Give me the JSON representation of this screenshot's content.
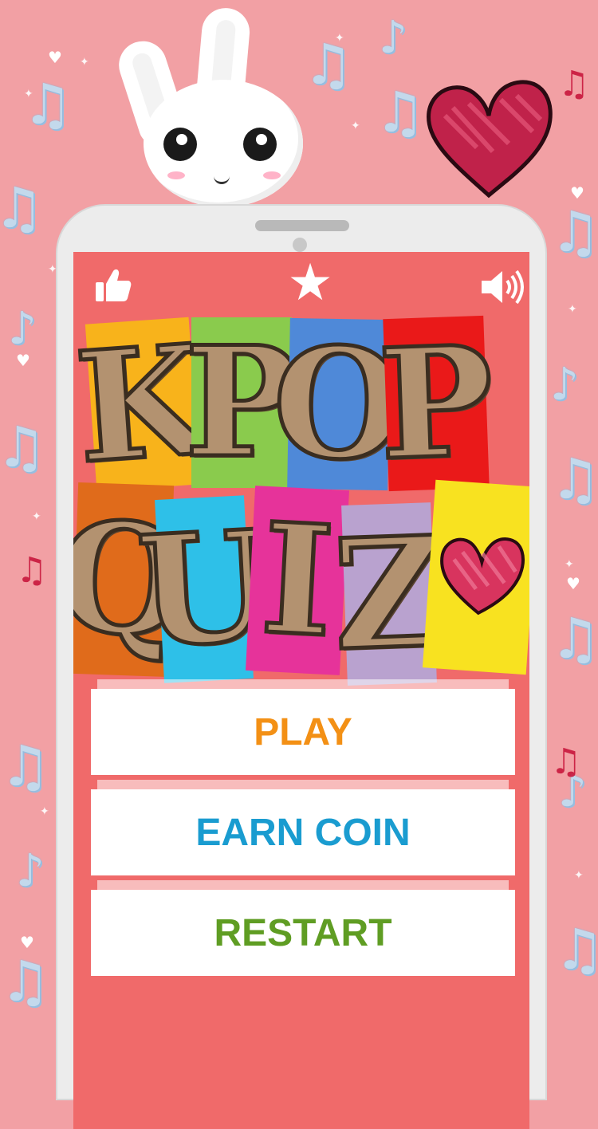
{
  "colors": {
    "background": "#f2a0a4",
    "screen": "#f06a6a",
    "play": "#f39015",
    "earn_coin": "#1a9cd0",
    "restart": "#5f9d23"
  },
  "icons": [
    "thumbs-up-icon",
    "star-icon",
    "speaker-icon"
  ],
  "logo": {
    "row1": [
      {
        "char": "K",
        "color": "#f8b31b"
      },
      {
        "char": "P",
        "color": "#8acb4d"
      },
      {
        "char": "O",
        "color": "#4f89d8"
      },
      {
        "char": "P",
        "color": "#ea1919"
      }
    ],
    "row2": [
      {
        "char": "Q",
        "color": "#e06b1b"
      },
      {
        "char": "U",
        "color": "#2ec0e8"
      },
      {
        "char": "I",
        "color": "#e6339a"
      },
      {
        "char": "Z",
        "color": "#b9a2cf"
      },
      {
        "char": "♥",
        "color": "#f8e220"
      }
    ]
  },
  "menu": {
    "play": "PLAY",
    "earn_coin": "EARN COIN",
    "restart": "RESTART"
  }
}
